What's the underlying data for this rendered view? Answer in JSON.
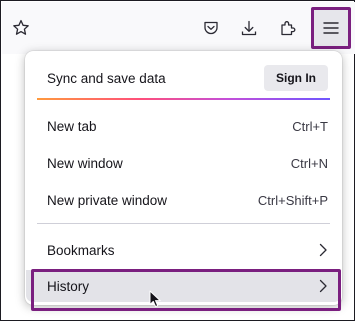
{
  "menu": {
    "sync_label": "Sync and save data",
    "sign_in_label": "Sign In",
    "items": [
      {
        "label": "New tab",
        "shortcut": "Ctrl+T"
      },
      {
        "label": "New window",
        "shortcut": "Ctrl+N"
      },
      {
        "label": "New private window",
        "shortcut": "Ctrl+Shift+P"
      }
    ],
    "bookmarks_label": "Bookmarks",
    "history_label": "History"
  },
  "icons": {
    "toolbar": [
      "star-icon",
      "pocket-icon",
      "download-icon",
      "extensions-icon",
      "hamburger-menu-icon"
    ],
    "submenu": "chevron-right-icon",
    "pointer": "mouse-cursor-icon"
  },
  "colors": {
    "highlight_border": "#7a1f7f",
    "sync_gradient": [
      "#ff9a3d",
      "#ff4f7a",
      "#c44fd9",
      "#6f56ff"
    ],
    "hover_background": "#e3e3e8"
  }
}
